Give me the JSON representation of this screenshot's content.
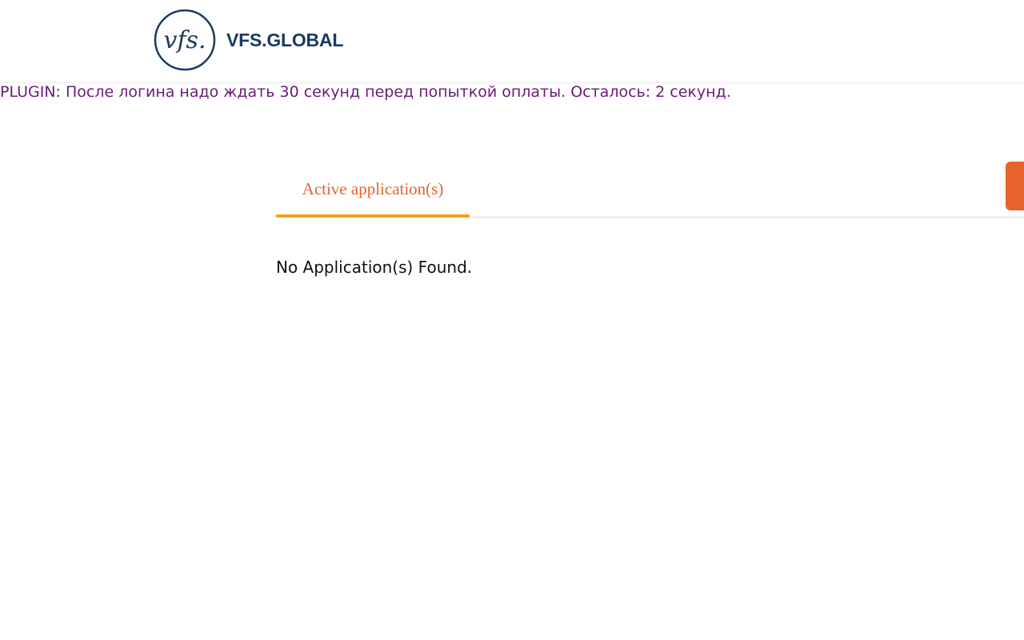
{
  "header": {
    "logo_text": "VFS.GLOBAL",
    "logo_mark_text": "vfs."
  },
  "plugin": {
    "message": "PLUGIN: После логина надо ждать 30 секунд перед попыткой оплаты. Осталось: 2 секунд."
  },
  "tabs": [
    {
      "label": "Active application(s)",
      "active": true
    }
  ],
  "main": {
    "empty_message": "No Application(s) Found."
  },
  "colors": {
    "brand_navy": "#1b3a5e",
    "plugin_text": "#6a1b7a",
    "accent_orange": "#e8632a",
    "tab_underline": "#f7a21b"
  }
}
